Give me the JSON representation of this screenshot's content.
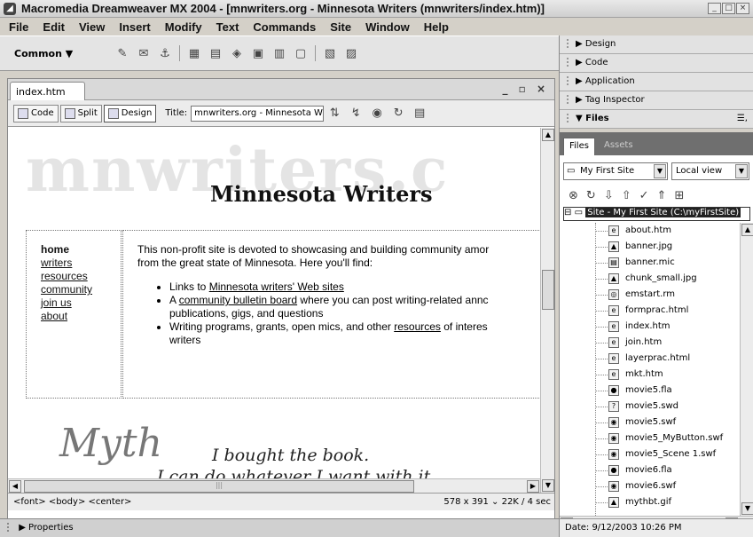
{
  "window": {
    "title": "Macromedia Dreamweaver MX 2004 - [mnwriters.org - Minnesota Writers (mnwriters/index.htm)]",
    "controls": [
      "_",
      "□",
      "×"
    ]
  },
  "menu": [
    "File",
    "Edit",
    "View",
    "Insert",
    "Modify",
    "Text",
    "Commands",
    "Site",
    "Window",
    "Help"
  ],
  "insert_bar": {
    "category": "Common ▼"
  },
  "document": {
    "tab": "index.htm",
    "win_controls": "_ ▫ ×",
    "views": [
      "Code",
      "Split",
      "Design"
    ],
    "title_label": "Title:",
    "title_value": "mnwriters.org - Minnesota Wri",
    "page": {
      "watermark": "mnwriters.c",
      "heading": "Minnesota Writers",
      "nav": [
        "home",
        "writers",
        "resources",
        "community",
        "join us",
        "about"
      ],
      "intro_1": "This non-profit site is devoted to showcasing and building community amor",
      "intro_2": "from the great state of Minnesota. Here you'll find:",
      "bullet1_pre": "Links to ",
      "bullet1_link": "Minnesota writers' Web sites",
      "bullet2_pre": "A ",
      "bullet2_link": "community bulletin board",
      "bullet2_post": " where you can post writing-related annc",
      "bullet2_line2": "publications, gigs, and questions",
      "bullet3_pre": "Writing programs, grants, open mics, and other ",
      "bullet3_link": "resources",
      "bullet3_post": " of interes",
      "bullet3_line2": "writers",
      "banner_script": "Myth",
      "banner_line1": "I bought the book.",
      "banner_line2": "I can do whatever I want with it"
    },
    "status_tags": "<font> <body> <center>",
    "status_info": "578 x 391 ⌄ 22K / 4 sec"
  },
  "properties_label": "▶ Properties",
  "panels": {
    "collapsed": [
      "▶ Design",
      "▶ Code",
      "▶ Application",
      "▶ Tag Inspector"
    ],
    "files_header": "▼ Files",
    "files_options": "☰,",
    "tabs": [
      "Files",
      "Assets"
    ],
    "site_select": "My First Site",
    "view_select": "Local view",
    "root": "Site - My First Site (C:\\myFirstSite)",
    "files": [
      "about.htm",
      "banner.jpg",
      "banner.mic",
      "chunk_small.jpg",
      "emstart.rm",
      "formprac.html",
      "index.htm",
      "join.htm",
      "layerprac.html",
      "mkt.htm",
      "movie5.fla",
      "movie5.swd",
      "movie5.swf",
      "movie5_MyButton.swf",
      "movie5_Scene 1.swf",
      "movie6.fla",
      "movie6.swf",
      "mythbt.gif"
    ],
    "date": "Date: 9/12/2003 10:26 PM"
  }
}
